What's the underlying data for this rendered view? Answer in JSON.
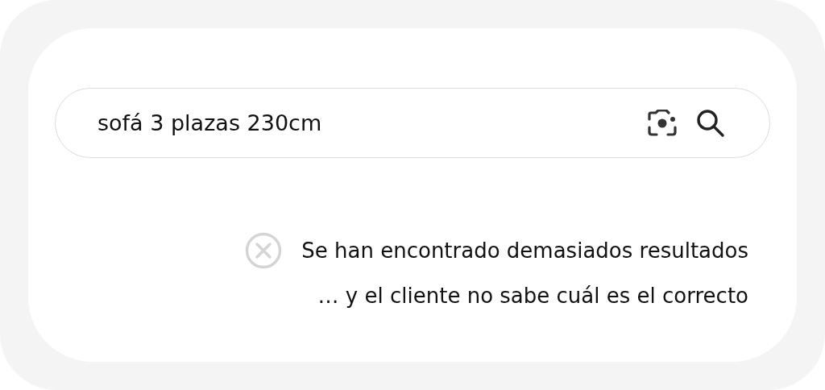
{
  "search": {
    "value": "sofá 3 plazas 230cm"
  },
  "message": {
    "kind": "error",
    "lines": [
      "Se han encontrado demasiados resultados",
      "… y el cliente no sabe cuál es el correcto"
    ]
  }
}
